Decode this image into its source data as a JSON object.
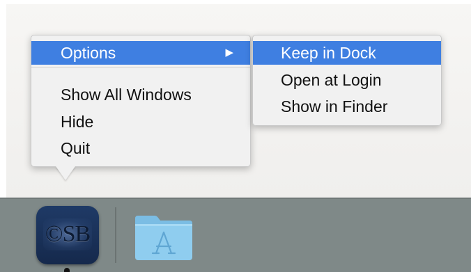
{
  "menu": {
    "items": [
      {
        "label": "Options",
        "has_submenu": true,
        "highlighted": true
      },
      {
        "label": "Show All Windows"
      },
      {
        "label": "Hide"
      },
      {
        "label": "Quit"
      }
    ],
    "submenu_arrow": "▶"
  },
  "submenu": {
    "items": [
      {
        "label": "Keep in Dock",
        "highlighted": true
      },
      {
        "label": "Open at Login"
      },
      {
        "label": "Show in Finder"
      }
    ]
  },
  "dock": {
    "app": {
      "logo_text": "©SB",
      "icon": "csb-app-icon"
    },
    "folder": {
      "icon": "applications-folder-icon"
    }
  },
  "colors": {
    "highlight": "#3f7fe1",
    "dock": "#7f8988",
    "folder": "#8cc8ea"
  }
}
